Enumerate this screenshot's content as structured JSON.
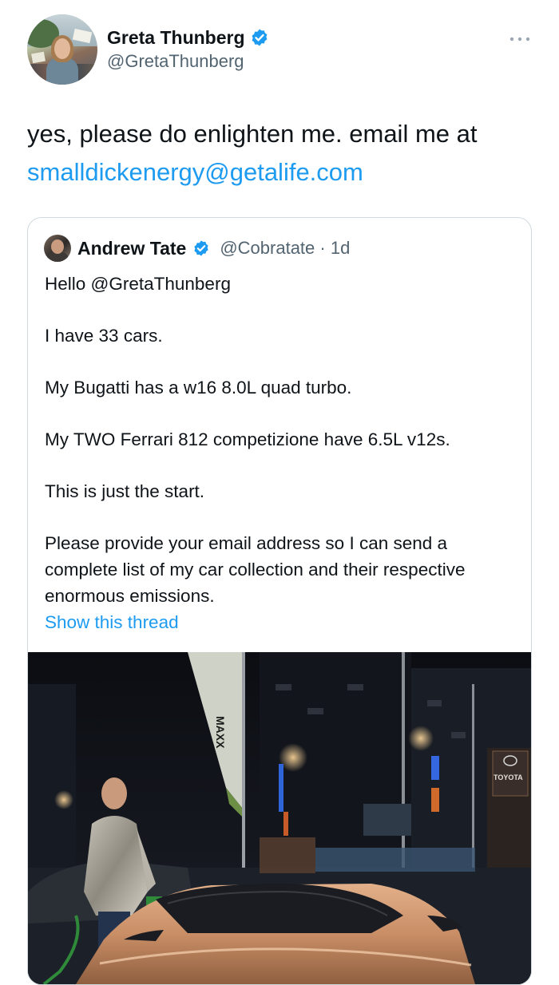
{
  "tweet": {
    "author_name": "Greta Thunberg",
    "author_handle": "@GretaThunberg",
    "more_icon": "more-dots-icon",
    "text_plain": "yes, please do enlighten me. email me at ",
    "text_link": "smalldickenergy@getalife.com"
  },
  "quote": {
    "author_name": "Andrew Tate",
    "author_handle": "@Cobratate · 1d",
    "paragraphs": [
      "Hello @GretaThunberg",
      "I have 33 cars.",
      "My Bugatti has a w16 8.0L quad turbo.",
      "My TWO Ferrari 812 competizione have 6.5L v12s.",
      "This is just the start.",
      "Please provide your email address so I can send a complete list of my car collection and their respective enormous emissions."
    ],
    "show_thread": "Show this thread",
    "photo": {
      "banner_text": "MAXX",
      "sign_text": "TOYOTA"
    }
  },
  "colors": {
    "link": "#1d9bf0",
    "verified": "#1d9bf0",
    "secondary_text": "#536471",
    "border": "#cfd9de"
  }
}
